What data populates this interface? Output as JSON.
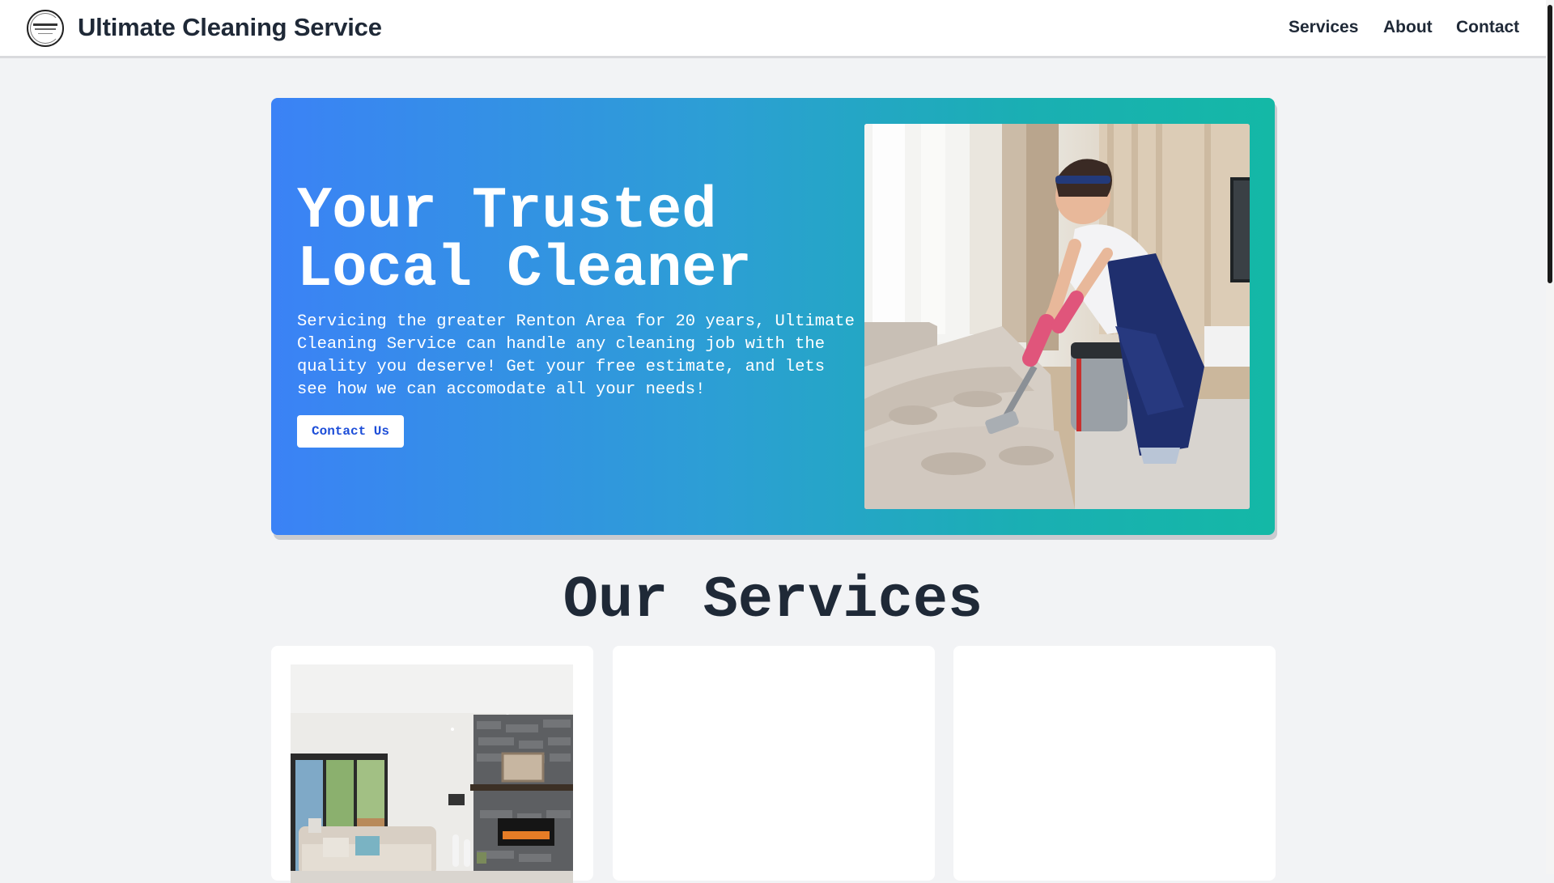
{
  "header": {
    "brand": "Ultimate Cleaning Service",
    "nav": {
      "services": "Services",
      "about": "About",
      "contact": "Contact"
    }
  },
  "hero": {
    "title_line1": "Your Trusted",
    "title_line2": "Local Cleaner",
    "description": "Servicing the greater Renton Area for 20 years, Ultimate Cleaning Service can handle any cleaning job with the quality you deserve! Get your free estimate, and lets see how we can accomodate all your needs!",
    "button": "Contact Us"
  },
  "services": {
    "title": "Our Services"
  },
  "colors": {
    "hero_gradient_start": "#3b82f6",
    "hero_gradient_end": "#14b8a6",
    "button_text": "#1d4ed8",
    "page_bg": "#f2f3f5"
  }
}
